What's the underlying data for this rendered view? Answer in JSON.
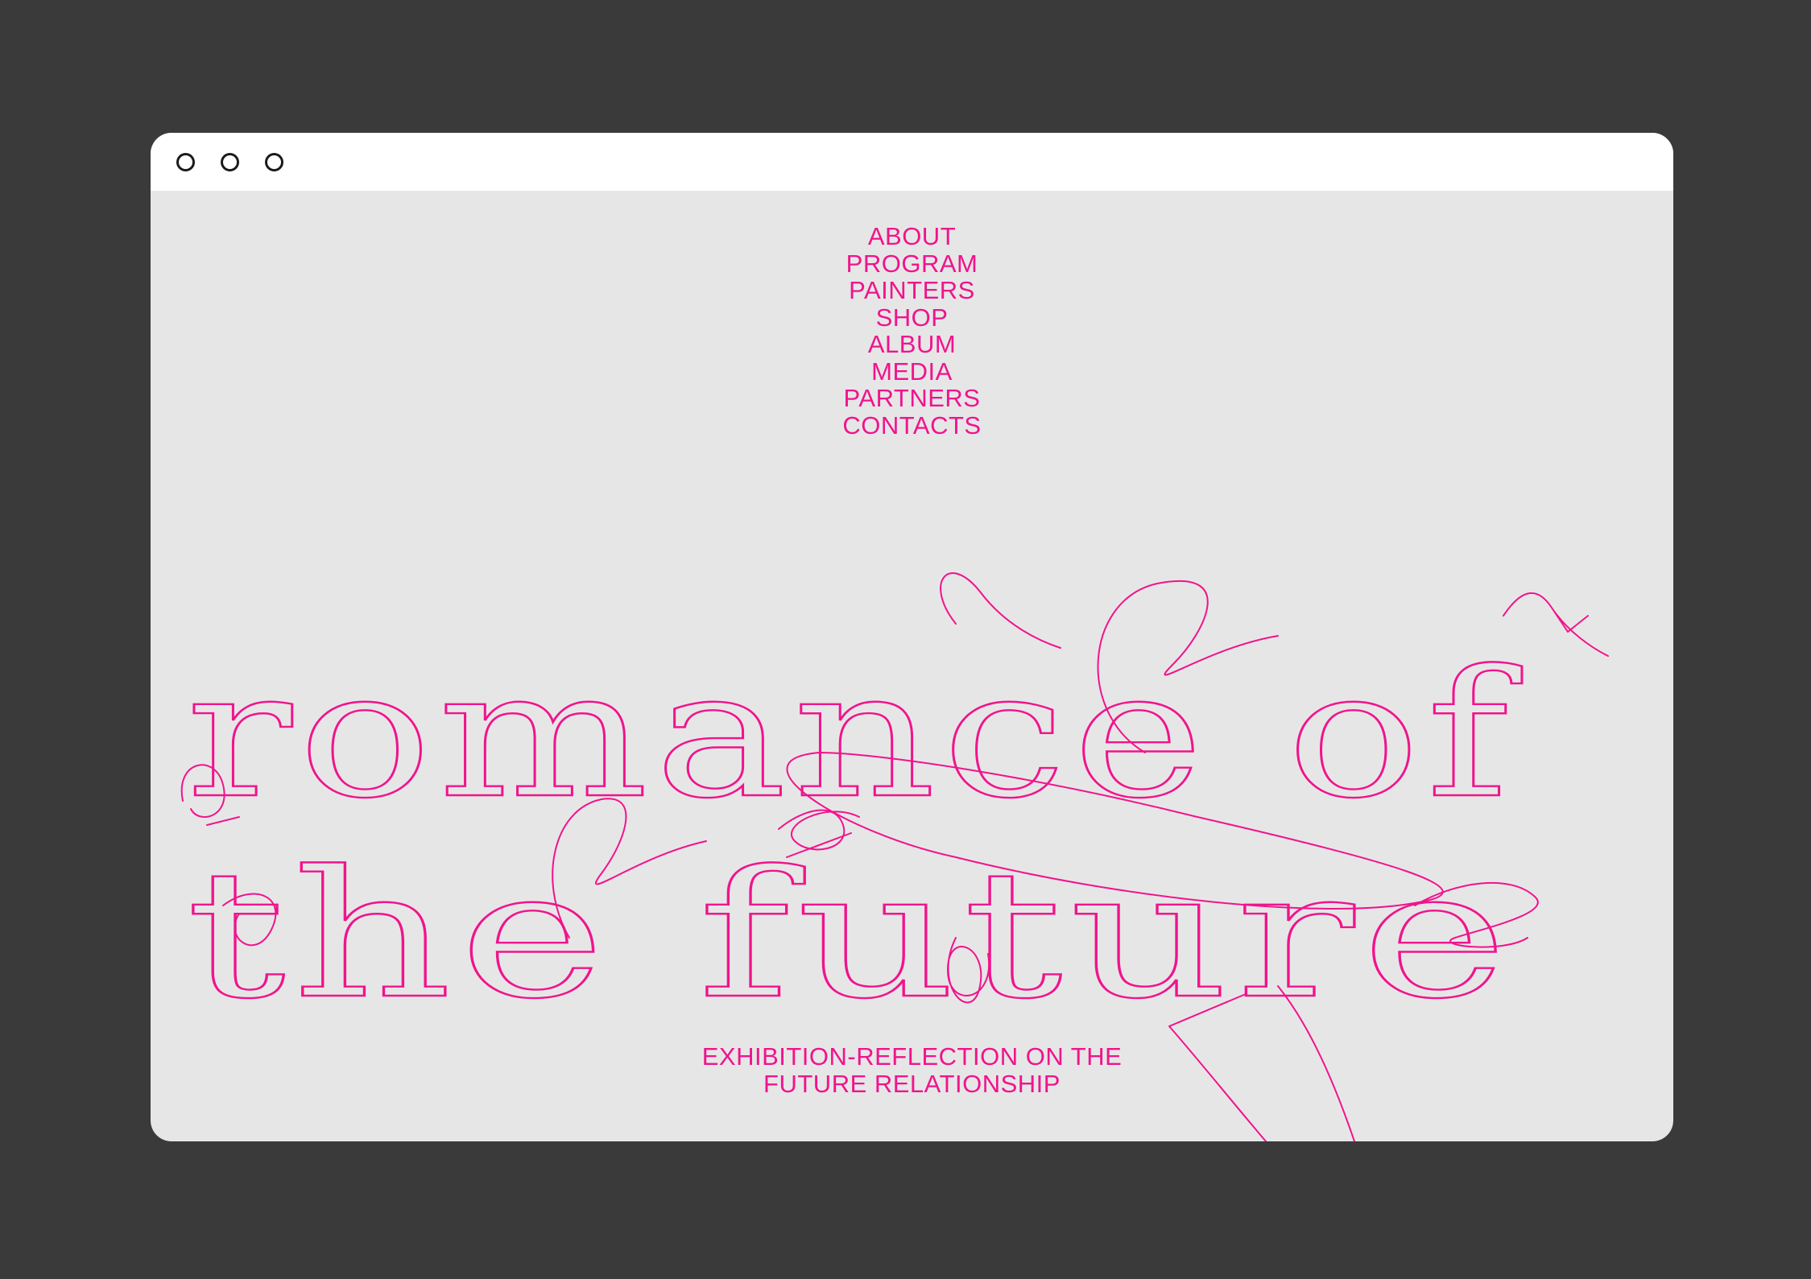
{
  "colors": {
    "backdrop": "#3a3a3a",
    "page_background": "#e7e6e7",
    "titlebar": "#ffffff",
    "accent": "#f0148c"
  },
  "window": {
    "controls": [
      "window-control-1",
      "window-control-2",
      "window-control-3"
    ]
  },
  "nav": {
    "items": [
      {
        "label": "ABOUT"
      },
      {
        "label": "PROGRAM"
      },
      {
        "label": "PAINTERS"
      },
      {
        "label": "SHOP"
      },
      {
        "label": "ALBUM"
      },
      {
        "label": "MEDIA"
      },
      {
        "label": "PARTNERS"
      },
      {
        "label": "CONTACTS"
      }
    ]
  },
  "hero": {
    "line1": "romance of",
    "line2": "the future"
  },
  "subtitle": {
    "line1": "EXHIBITION-REFLECTION ON THE",
    "line2": "FUTURE RELATIONSHIP"
  }
}
